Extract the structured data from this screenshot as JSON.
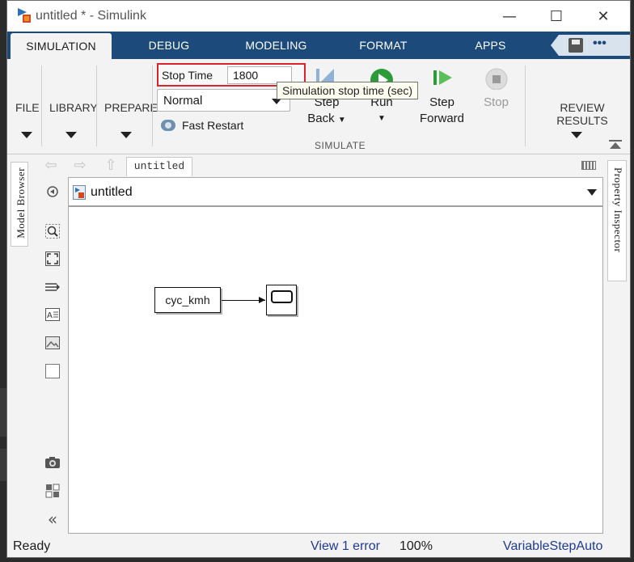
{
  "window": {
    "title": "untitled * - Simulink",
    "minimize": "—",
    "maximize": "☐",
    "close": "✕"
  },
  "tabs": [
    {
      "label": "SIMULATION",
      "active": true
    },
    {
      "label": "DEBUG"
    },
    {
      "label": "MODELING"
    },
    {
      "label": "FORMAT"
    },
    {
      "label": "APPS"
    }
  ],
  "quick_access": {
    "more": "•••"
  },
  "ribbon": {
    "file": "FILE",
    "library": "LIBRARY",
    "prepare": "PREPARE",
    "stop_time_label": "Stop Time",
    "stop_time_value": "1800",
    "sim_mode": "Normal",
    "fast_restart": "Fast Restart",
    "step_back_1": "Step",
    "step_back_2": "Back",
    "run": "Run",
    "step_forward_1": "Step",
    "step_forward_2": "Forward",
    "stop": "Stop",
    "simulate_group": "SIMULATE",
    "review_results": "REVIEW RESULTS",
    "tooltip": "Simulation stop time (sec)"
  },
  "side_tabs": {
    "model_browser": "Model Browser",
    "property_inspector": "Property Inspector"
  },
  "editor": {
    "doc_tab": "untitled",
    "breadcrumb": "untitled"
  },
  "model": {
    "from_block_label": "cyc_kmh"
  },
  "status": {
    "ready": "Ready",
    "errors": "View 1 error",
    "zoom": "100%",
    "solver": "VariableStepAuto"
  },
  "colors": {
    "tab_bar": "#1c4a7a",
    "highlight": "#d9232e",
    "run_green": "#2e9b3b",
    "link_blue": "#1f3a93"
  }
}
